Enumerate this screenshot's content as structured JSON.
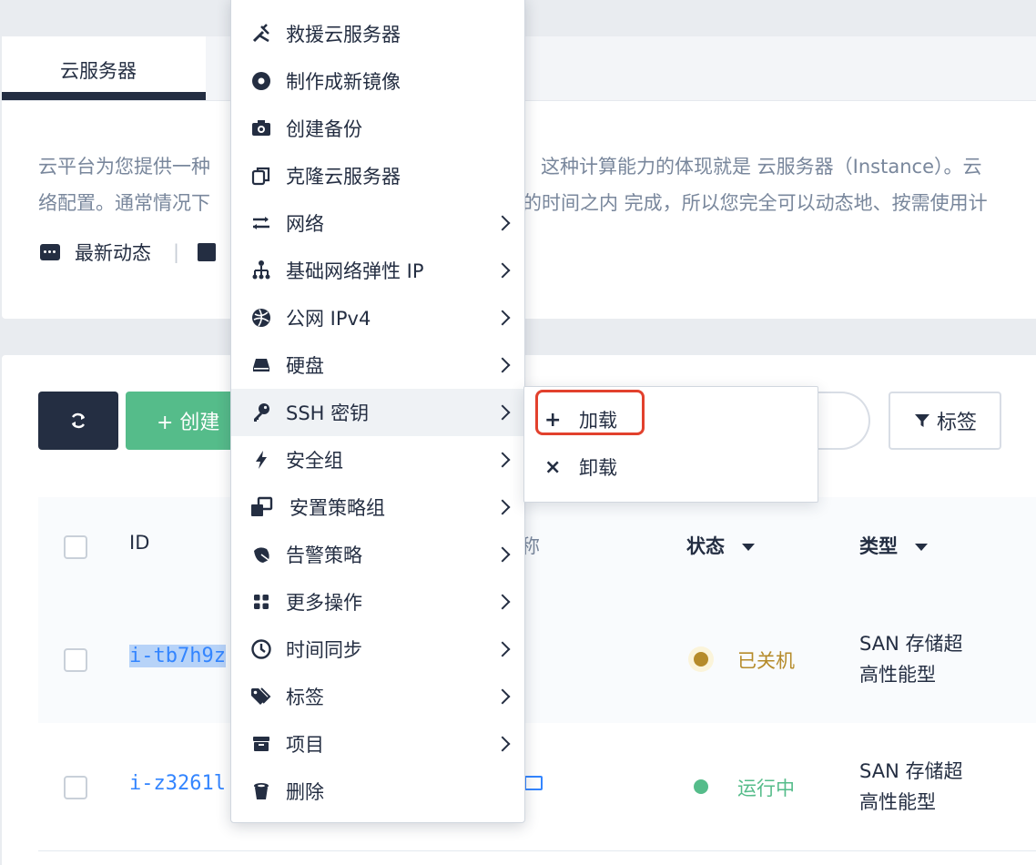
{
  "tabs": {
    "active": "云服务器"
  },
  "intro": {
    "line1_left": "云平台为您提供一种",
    "line1_right": "这种计算能力的体现就是 云服务器（Instance）。云",
    "line2_left": "络配置。通常情况下",
    "line2_right": "的时间之内 完成，所以您完全可以动态地、按需使用计",
    "news_link": "最新动态"
  },
  "toolbar": {
    "create_label": "+ 创建",
    "tag_label": "标签"
  },
  "table": {
    "headers": {
      "id": "ID",
      "name": "称",
      "status": "状态",
      "type": "类型"
    },
    "rows": [
      {
        "id": "i-tb7h9z",
        "status": "已关机",
        "status_color": "#b58b2a",
        "type_line1": "SAN 存储超",
        "type_line2": "高性能型"
      },
      {
        "id": "i-z3261l",
        "status": "运行中",
        "status_color": "#55bc8a",
        "type_line1": "SAN 存储超",
        "type_line2": "高性能型"
      }
    ]
  },
  "menu": {
    "items": [
      {
        "label": "救援云服务器",
        "icon": "tools-icon",
        "submenu": false
      },
      {
        "label": "制作成新镜像",
        "icon": "disc-icon",
        "submenu": false
      },
      {
        "label": "创建备份",
        "icon": "camera-icon",
        "submenu": false
      },
      {
        "label": "克隆云服务器",
        "icon": "clone-icon",
        "submenu": false
      },
      {
        "label": "网络",
        "icon": "network-icon",
        "submenu": true
      },
      {
        "label": "基础网络弹性 IP",
        "icon": "topology-icon",
        "submenu": true
      },
      {
        "label": "公网 IPv4",
        "icon": "globe-icon",
        "submenu": true
      },
      {
        "label": "硬盘",
        "icon": "disk-icon",
        "submenu": true
      },
      {
        "label": "SSH 密钥",
        "icon": "key-icon",
        "submenu": true
      },
      {
        "label": "安全组",
        "icon": "bolt-icon",
        "submenu": true
      },
      {
        "label": "安置策略组",
        "icon": "placement-icon",
        "submenu": true
      },
      {
        "label": "告警策略",
        "icon": "bell-icon",
        "submenu": true
      },
      {
        "label": "更多操作",
        "icon": "grid-icon",
        "submenu": true
      },
      {
        "label": "时间同步",
        "icon": "clock-icon",
        "submenu": true
      },
      {
        "label": "标签",
        "icon": "tag-icon",
        "submenu": true
      },
      {
        "label": "项目",
        "icon": "archive-icon",
        "submenu": true
      },
      {
        "label": "删除",
        "icon": "trash-icon",
        "submenu": false
      }
    ],
    "active_index": 8
  },
  "submenu": {
    "items": [
      {
        "symbol": "+",
        "label": "加载"
      },
      {
        "symbol": "×",
        "label": "卸载"
      }
    ]
  },
  "colors": {
    "primary_dark": "#242e42",
    "green": "#55bc8a",
    "highlight": "#e2412d",
    "link": "#3385ff"
  }
}
